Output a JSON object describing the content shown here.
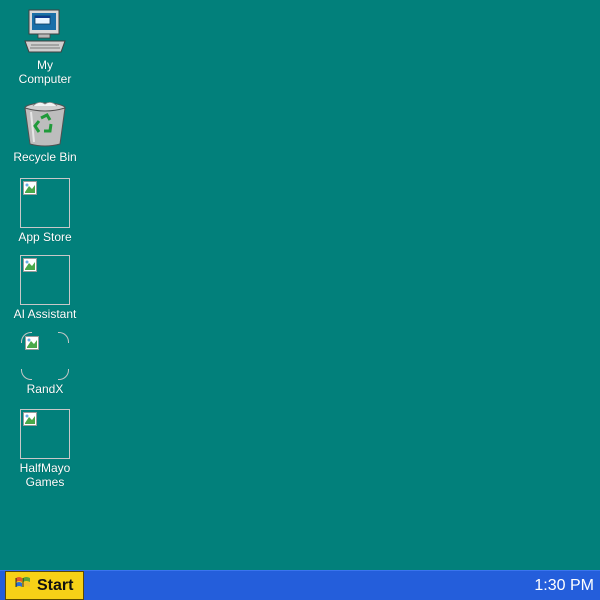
{
  "desktop": {
    "background_color": "#02807b",
    "icons": [
      {
        "label": "My\nComputer",
        "icon": "computer-icon"
      },
      {
        "label": "Recycle Bin",
        "icon": "recycle-bin-icon"
      },
      {
        "label": "App Store",
        "icon": "broken-image-icon"
      },
      {
        "label": "AI Assistant",
        "icon": "broken-image-icon"
      },
      {
        "label": "RandX",
        "icon": "broken-image-icon"
      },
      {
        "label": "HalfMayo\nGames",
        "icon": "broken-image-icon"
      }
    ]
  },
  "taskbar": {
    "background_color": "#245edb",
    "start_label": "Start",
    "start_color": "#f7d117",
    "clock": "1:30 PM"
  }
}
